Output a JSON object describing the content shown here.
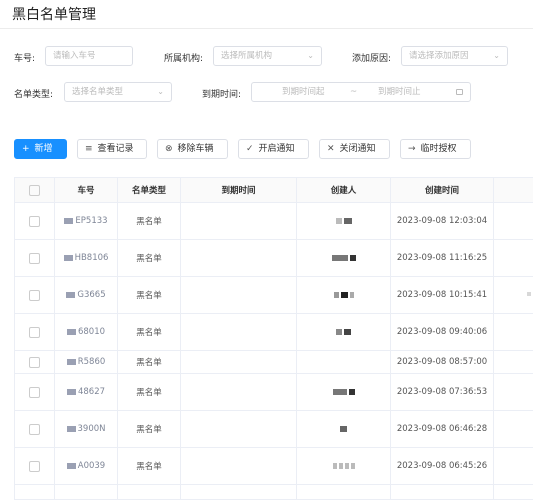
{
  "page": {
    "title": "黑白名单管理"
  },
  "filters": {
    "plate": {
      "label": "车号:",
      "placeholder": "请输入车号"
    },
    "org": {
      "label": "所属机构:",
      "placeholder": "选择所属机构"
    },
    "reason": {
      "label": "添加原因:",
      "placeholder": "请选择添加原因"
    },
    "list_type": {
      "label": "名单类型:",
      "placeholder": "选择名单类型"
    },
    "expire": {
      "label": "到期时间:",
      "start_placeholder": "到期时间起",
      "separator": "~",
      "end_placeholder": "到期时间止"
    }
  },
  "toolbar": {
    "add": "新增",
    "view_records": "查看记录",
    "remove_vehicle": "移除车辆",
    "enable_notify": "开启通知",
    "disable_notify": "关闭通知",
    "temp_auth": "临时授权"
  },
  "table": {
    "headers": [
      "车号",
      "名单类型",
      "到期时间",
      "创建人",
      "创建时间"
    ],
    "rows": [
      {
        "plate": "EP5133",
        "type": "黑名单",
        "expire": "",
        "created": "2023-09-08 12:03:04"
      },
      {
        "plate": "HB8106",
        "type": "黑名单",
        "expire": "",
        "created": "2023-09-08 11:16:25"
      },
      {
        "plate": "G3665",
        "type": "黑名单",
        "expire": "",
        "created": "2023-09-08 10:15:41"
      },
      {
        "plate": "68010",
        "type": "黑名单",
        "expire": "",
        "created": "2023-09-08 09:40:06"
      },
      {
        "plate": "R5860",
        "type": "黑名单",
        "expire": "",
        "created": "2023-09-08 08:57:00"
      },
      {
        "plate": "48627",
        "type": "黑名单",
        "expire": "",
        "created": "2023-09-08 07:36:53"
      },
      {
        "plate": "3900N",
        "type": "黑名单",
        "expire": "",
        "created": "2023-09-08 06:46:28"
      },
      {
        "plate": "A0039",
        "type": "黑名单",
        "expire": "",
        "created": "2023-09-08 06:45:26"
      }
    ]
  },
  "colors": {
    "primary": "#1890ff",
    "border": "#dcdfe6",
    "header_bg": "#fafafa"
  },
  "icons": {
    "add": "plus-icon",
    "records": "list-icon",
    "remove": "close-circle-icon",
    "enable": "check-icon",
    "disable": "close-icon",
    "auth": "arrow-right-icon",
    "select": "chevron-down-icon",
    "date": "calendar-icon"
  }
}
